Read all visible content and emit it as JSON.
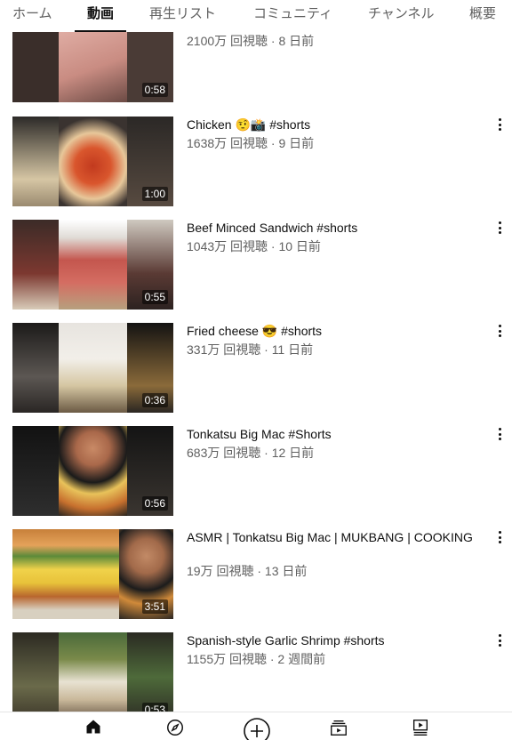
{
  "tabs": [
    {
      "label": "ホーム"
    },
    {
      "label": "動画"
    },
    {
      "label": "再生リスト"
    },
    {
      "label": "コミュニティ"
    },
    {
      "label": "チャンネル"
    },
    {
      "label": "概要"
    }
  ],
  "active_tab": "動画",
  "videos": [
    {
      "title": "",
      "meta": "2100万 回視聴 · 8 日前",
      "duration": "0:58"
    },
    {
      "title": "Chicken 🤨📸 #shorts",
      "meta": "1638万 回視聴 · 9 日前",
      "duration": "1:00"
    },
    {
      "title": "Beef Minced Sandwich #shorts",
      "meta": "1043万 回視聴 · 10 日前",
      "duration": "0:55"
    },
    {
      "title": "Fried cheese 😎 #shorts",
      "meta": "331万 回視聴 · 11 日前",
      "duration": "0:36"
    },
    {
      "title": "Tonkatsu Big Mac #Shorts",
      "meta": "683万 回視聴 · 12 日前",
      "duration": "0:56"
    },
    {
      "title": "ASMR | Tonkatsu Big Mac | MUKBANG | COOKING",
      "meta": "19万 回視聴 · 13 日前",
      "duration": "3:51"
    },
    {
      "title": "Spanish-style Garlic Shrimp #shorts",
      "meta": "1155万 回視聴 · 2 週間前",
      "duration": "0:53"
    }
  ],
  "bottom_nav": [
    {
      "icon": "home-icon"
    },
    {
      "icon": "explore-icon"
    },
    {
      "icon": "create-icon"
    },
    {
      "icon": "subscriptions-icon"
    },
    {
      "icon": "library-icon"
    }
  ]
}
